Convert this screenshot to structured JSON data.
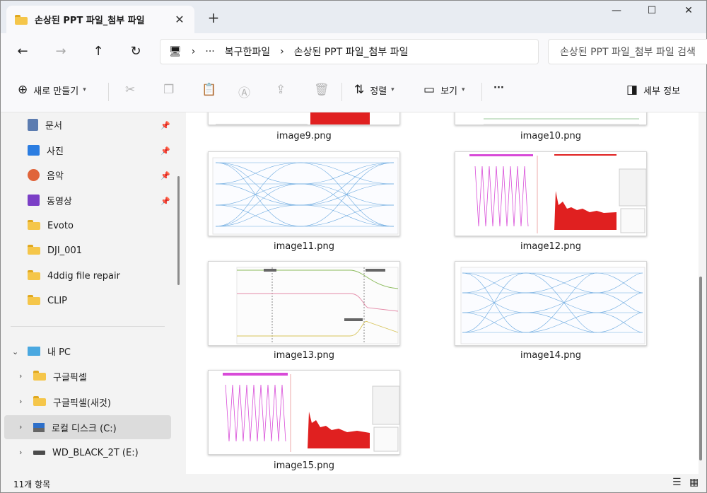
{
  "tab": {
    "title": "손상된 PPT 파일_첨부 파일",
    "close": "✕",
    "new_tab": "+"
  },
  "window_controls": {
    "minimize": "—",
    "maximize": "☐",
    "close": "✕"
  },
  "nav": {
    "back": "←",
    "forward": "→",
    "up": "↑",
    "refresh": "↻"
  },
  "address": {
    "pc_icon": "🖥",
    "sep1": "›",
    "more": "···",
    "crumb1": "복구한파일",
    "sep2": "›",
    "crumb2": "손상된 PPT 파일_첨부 파일"
  },
  "search": {
    "placeholder": "손상된 PPT 파일_첨부 파일 검색"
  },
  "toolbar": {
    "new_label": "새로 만들기",
    "sort_label": "정렬",
    "view_label": "보기",
    "more_label": "···",
    "details_label": "세부 정보"
  },
  "sidebar": {
    "pinned": [
      {
        "label": "문서",
        "icon": "document-icon"
      },
      {
        "label": "사진",
        "icon": "photo-icon"
      },
      {
        "label": "음악",
        "icon": "music-icon"
      },
      {
        "label": "동영상",
        "icon": "video-icon"
      }
    ],
    "folders": [
      "Evoto",
      "DJI_001",
      "4ddig file repair",
      "CLIP"
    ],
    "this_pc": "내 PC",
    "pc_items": [
      "구글픽셀",
      "구글픽셀(새것)",
      "로컬 디스크 (C:)",
      "WD_BLACK_2T (E:)"
    ]
  },
  "files": [
    {
      "name": "image9.png"
    },
    {
      "name": "image10.png"
    },
    {
      "name": "image11.png"
    },
    {
      "name": "image12.png"
    },
    {
      "name": "image13.png"
    },
    {
      "name": "image14.png"
    },
    {
      "name": "image15.png"
    }
  ],
  "status": {
    "count": "11개 항목",
    "details_view": "☰",
    "tiles_view": "▦"
  },
  "colors": {
    "accent": "#0067c0",
    "folder": "#f5c64a",
    "eye": "#3d8fd6",
    "signal": "#d84bd8",
    "spectrum": "#e02020"
  }
}
